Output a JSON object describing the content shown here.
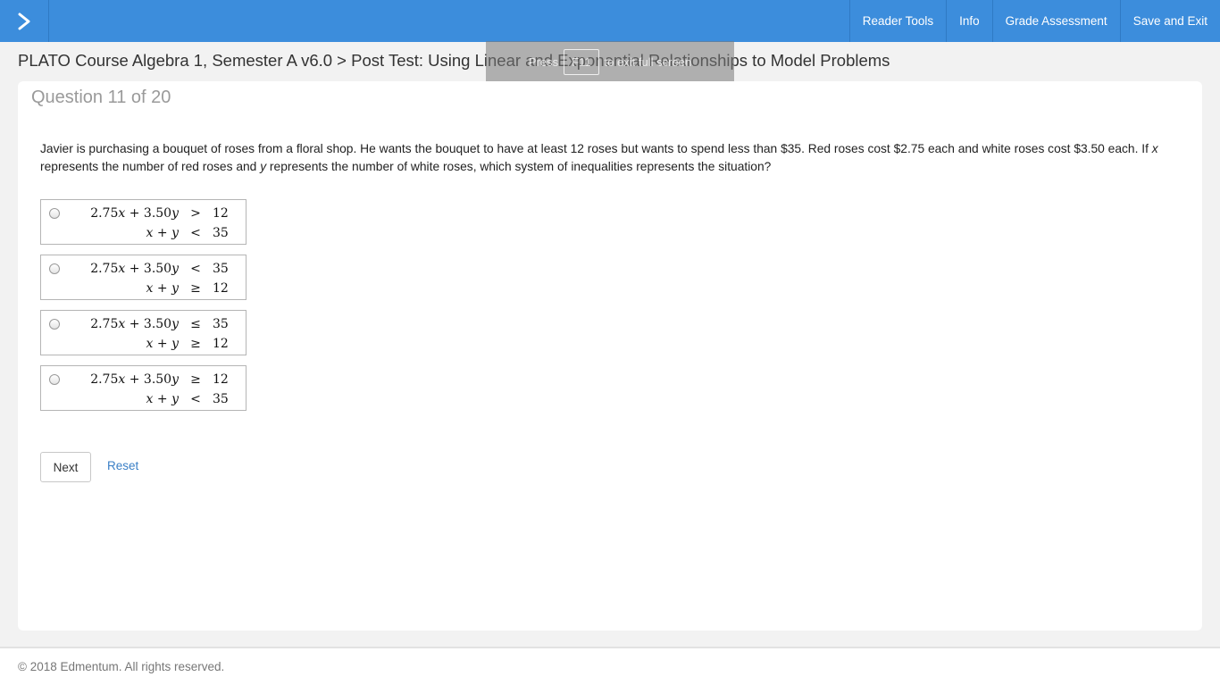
{
  "topbar": {
    "toggle_icon": "chevron-right-icon",
    "nav": [
      "Reader Tools",
      "Info",
      "Grade Assessment",
      "Save and Exit"
    ],
    "color": "#3c8ddc"
  },
  "breadcrumb": "PLATO Course Algebra 1, Semester A v6.0 > Post Test: Using Linear and Exponential Relationships to Model Problems",
  "toast": {
    "prefix": "Press",
    "key": "F11",
    "suffix": "to exit full screen"
  },
  "question": {
    "title": "Question 11 of 20",
    "text_part1": "Javier is purchasing a bouquet of roses from a floral shop. He wants the bouquet to have at least 12 roses but wants to spend less than $35. Red roses cost $2.75 each and white roses cost $3.50 each. If ",
    "var_x": "x",
    "text_part2": " represents the number of red roses and ",
    "var_y": "y",
    "text_part3": " represents the number of white roses, which system of inequalities represents the situation?"
  },
  "options": [
    {
      "line1": {
        "coef_x": "2.75",
        "coef_y": "3.50",
        "rel": ">",
        "rhs": "12"
      },
      "line2": {
        "rel": "<",
        "rhs": "35"
      }
    },
    {
      "line1": {
        "coef_x": "2.75",
        "coef_y": "3.50",
        "rel": "<",
        "rhs": "35"
      },
      "line2": {
        "rel": "≥",
        "rhs": "12"
      }
    },
    {
      "line1": {
        "coef_x": "2.75",
        "coef_y": "3.50",
        "rel": "≤",
        "rhs": "35"
      },
      "line2": {
        "rel": "≥",
        "rhs": "12"
      }
    },
    {
      "line1": {
        "coef_x": "2.75",
        "coef_y": "3.50",
        "rel": "≥",
        "rhs": "12"
      },
      "line2": {
        "rel": "<",
        "rhs": "35"
      }
    }
  ],
  "math_symbols": {
    "plus": "+",
    "x": "x",
    "y": "y"
  },
  "buttons": {
    "next": "Next",
    "reset": "Reset"
  },
  "footer": "© 2018 Edmentum. All rights reserved."
}
